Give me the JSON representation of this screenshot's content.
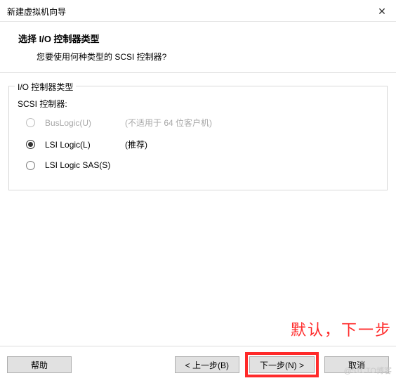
{
  "titlebar": {
    "title": "新建虚拟机向导",
    "close": "✕"
  },
  "header": {
    "title": "选择 I/O 控制器类型",
    "subtitle": "您要使用何种类型的 SCSI 控制器?"
  },
  "group": {
    "legend": "I/O 控制器类型",
    "scsi_label": "SCSI 控制器:",
    "options": [
      {
        "key": "buslogic",
        "label": "BusLogic(U)",
        "hint": "(不适用于 64 位客户机)",
        "checked": false,
        "disabled": true
      },
      {
        "key": "lsilogic",
        "label": "LSI Logic(L)",
        "hint": "(推荐)",
        "checked": true,
        "disabled": false
      },
      {
        "key": "lsisas",
        "label": "LSI Logic SAS(S)",
        "hint": "",
        "checked": false,
        "disabled": false
      }
    ]
  },
  "annotation": "默认，下一步",
  "buttons": {
    "help": "帮助",
    "back": "< 上一步(B)",
    "next": "下一步(N) >",
    "cancel": "取消"
  },
  "watermark": "@51CTO博客"
}
